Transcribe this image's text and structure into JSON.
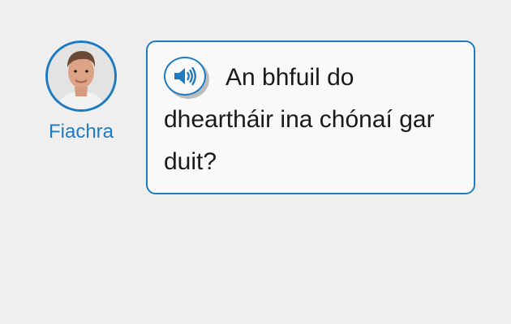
{
  "speaker": {
    "name": "Fiachra",
    "avatar_icon": "person-photo-icon"
  },
  "bubble": {
    "audio_icon": "speaker-volume-icon",
    "text": "An bhfuil do dheartháir ina chónaí gar duit?"
  },
  "colors": {
    "accent": "#1f7bc1",
    "background": "#efefef",
    "bubble_background": "#f9f9f9",
    "text": "#1a1a1a"
  }
}
